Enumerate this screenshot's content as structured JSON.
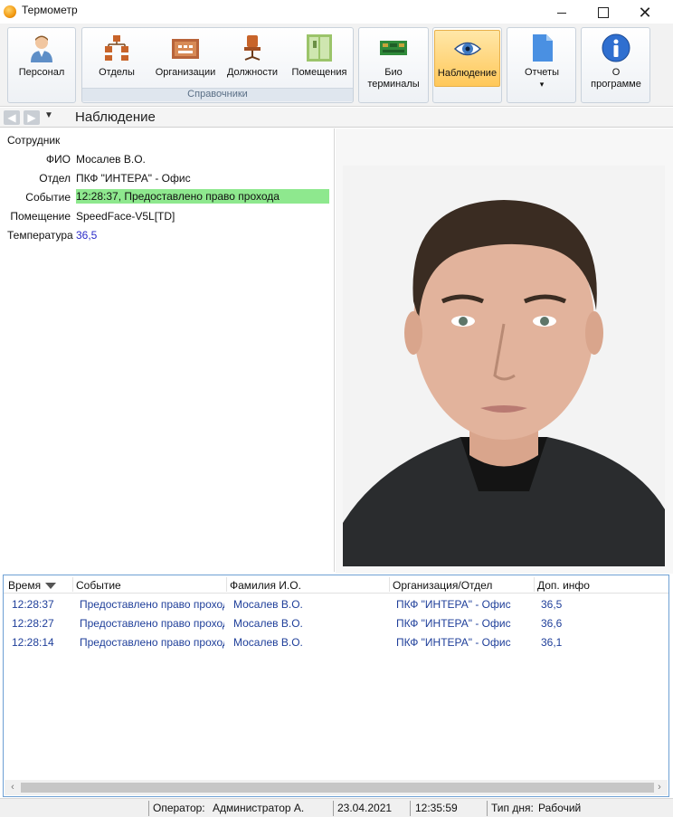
{
  "window": {
    "title": "Термометр"
  },
  "ribbon": {
    "personnel": "Персонал",
    "departments": "Отделы",
    "organizations": "Организации",
    "positions": "Должности",
    "rooms": "Помещения",
    "directories_caption": "Справочники",
    "bio_terminals_line1": "Био",
    "bio_terminals_line2": "терминалы",
    "monitoring": "Наблюдение",
    "reports": "Отчеты",
    "reports_arrow": "▾",
    "about_line1": "О",
    "about_line2": "программе"
  },
  "nav": {
    "page_title": "Наблюдение"
  },
  "employee": {
    "section_title": "Сотрудник",
    "fio_label": "ФИО",
    "fio": "Мосалев В.О.",
    "dept_label": "Отдел",
    "dept": "ПКФ \"ИНТЕРА\" - Офис",
    "event_label": "Событие",
    "event": "12:28:37, Предоставлено право прохода",
    "room_label": "Помещение",
    "room": "SpeedFace-V5L[TD]",
    "temp_label": "Температура",
    "temp": "36,5"
  },
  "grid": {
    "columns": [
      "Время",
      "Событие",
      "Фамилия И.О.",
      "Организация/Отдел",
      "Доп. инфо"
    ],
    "rows": [
      [
        "12:28:37",
        "Предоставлено право прохода",
        "Мосалев В.О.",
        "ПКФ \"ИНТЕРА\" - Офис",
        "36,5"
      ],
      [
        "12:28:27",
        "Предоставлено право прохода",
        "Мосалев В.О.",
        "ПКФ \"ИНТЕРА\" - Офис",
        "36,6"
      ],
      [
        "12:28:14",
        "Предоставлено право прохода",
        "Мосалев В.О.",
        "ПКФ \"ИНТЕРА\" - Офис",
        "36,1"
      ]
    ]
  },
  "status": {
    "operator_label": "Оператор:",
    "operator": "Администратор А.",
    "date": "23.04.2021",
    "time": "12:35:59",
    "day_type_label": "Тип дня:",
    "day_type": "Рабочий"
  },
  "colors": {
    "event_highlight": "#8ee88e",
    "active_button": "#ffc85a",
    "grid_text": "#1f3f9a",
    "temp_text": "#2a2ac8"
  }
}
